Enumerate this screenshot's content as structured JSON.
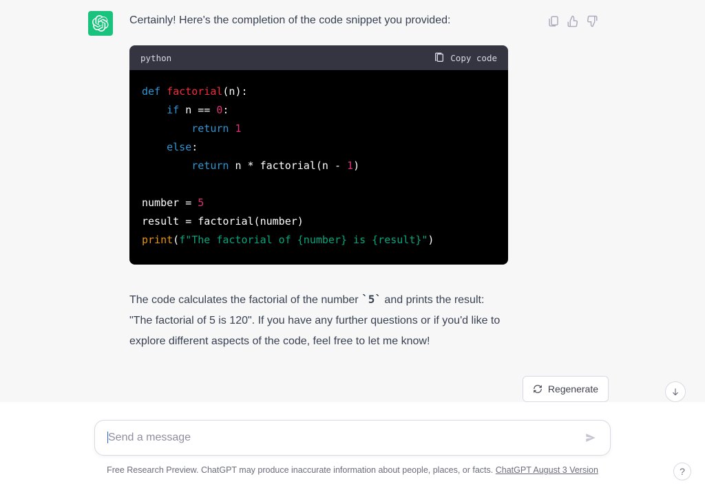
{
  "message": {
    "intro": "Certainly! Here's the completion of the code snippet you provided:",
    "follow_p1": "The code calculates the factorial of the number ",
    "follow_code": "`5`",
    "follow_p2": " and prints the result: \"The factorial of 5 is 120\". If you have any further questions or if you'd like to explore different aspects of the code, feel free to let me know!"
  },
  "code": {
    "language": "python",
    "copy_label": "Copy code",
    "tokens": [
      {
        "t": "kw",
        "v": "def"
      },
      {
        "t": "plain",
        "v": " "
      },
      {
        "t": "def-name",
        "v": "factorial"
      },
      {
        "t": "plain",
        "v": "(n):\n    "
      },
      {
        "t": "kw",
        "v": "if"
      },
      {
        "t": "plain",
        "v": " n == "
      },
      {
        "t": "num",
        "v": "0"
      },
      {
        "t": "plain",
        "v": ":\n        "
      },
      {
        "t": "kw",
        "v": "return"
      },
      {
        "t": "plain",
        "v": " "
      },
      {
        "t": "num",
        "v": "1"
      },
      {
        "t": "plain",
        "v": "\n    "
      },
      {
        "t": "kw",
        "v": "else"
      },
      {
        "t": "plain",
        "v": ":\n        "
      },
      {
        "t": "kw",
        "v": "return"
      },
      {
        "t": "plain",
        "v": " n * factorial(n - "
      },
      {
        "t": "num",
        "v": "1"
      },
      {
        "t": "plain",
        "v": ")\n\n"
      },
      {
        "t": "plain",
        "v": "number = "
      },
      {
        "t": "num",
        "v": "5"
      },
      {
        "t": "plain",
        "v": "\n"
      },
      {
        "t": "plain",
        "v": "result = factorial(number)\n"
      },
      {
        "t": "fn",
        "v": "print"
      },
      {
        "t": "plain",
        "v": "("
      },
      {
        "t": "str",
        "v": "f\"The factorial of {number} is {result}\""
      },
      {
        "t": "plain",
        "v": ")"
      }
    ]
  },
  "actions": {
    "regenerate_label": "Regenerate"
  },
  "composer": {
    "placeholder": "Send a message"
  },
  "footer": {
    "text": "Free Research Preview. ChatGPT may produce inaccurate information about people, places, or facts. ",
    "link_label": "ChatGPT August 3 Version"
  },
  "help": {
    "label": "?"
  }
}
